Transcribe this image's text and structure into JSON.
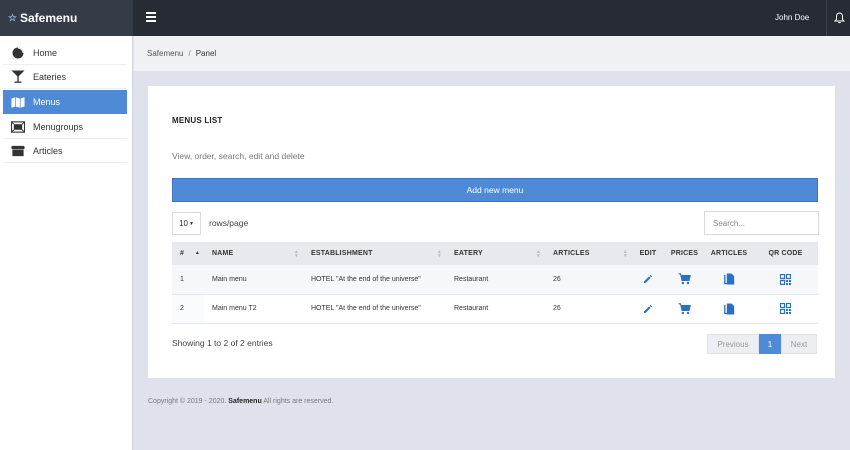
{
  "brand": {
    "name": "Safemenu",
    "star": "☆"
  },
  "topbar": {
    "user": "John Doe"
  },
  "sidebar": {
    "items": [
      {
        "label": "Home",
        "icon": "pie-chart-icon",
        "active": false
      },
      {
        "label": "Eateries",
        "icon": "cocktail-glass-icon",
        "active": false
      },
      {
        "label": "Menus",
        "icon": "map-icon",
        "active": true
      },
      {
        "label": "Menugroups",
        "icon": "tray-icon",
        "active": false
      },
      {
        "label": "Articles",
        "icon": "box-icon",
        "active": false
      }
    ]
  },
  "breadcrumb": {
    "root": "Safemenu",
    "separator": "/",
    "current": "Panel"
  },
  "card": {
    "title": "MENUS LIST",
    "subtitle": "View, order, search, edit and delete",
    "add_button": "Add new menu"
  },
  "controls": {
    "rows_value": "10",
    "rows_label": "rows/page",
    "search_placeholder": "Search..."
  },
  "table": {
    "headers": {
      "idx": "#",
      "name": "NAME",
      "establishment": "ESTABLISHMENT",
      "eatery": "EATERY",
      "articles": "ARTICLES",
      "edit": "EDIT",
      "prices": "PRICES",
      "articles_action": "ARTICLES",
      "qrcode": "QR CODE"
    },
    "rows": [
      {
        "idx": "1",
        "name": "Main menu",
        "establishment": "HOTEL \"At the end of the universe\"",
        "eatery": "Restaurant",
        "articles": "26"
      },
      {
        "idx": "2",
        "name": "Main menu T2",
        "establishment": "HOTEL \"At the end of the universe\"",
        "eatery": "Restaurant",
        "articles": "26"
      }
    ]
  },
  "info": "Showing 1 to 2 of 2 entries",
  "pager": {
    "prev": "Previous",
    "page": "1",
    "next": "Next"
  },
  "footer": {
    "prefix": "Copyright © 2019 - 2020.",
    "brand": "Safemenu",
    "suffix": "All rights are reserved."
  },
  "colors": {
    "accent": "#4f8ad6",
    "action_icon": "#2b6fc2",
    "topbar": "#262b34",
    "brand_bg": "#353b47"
  }
}
